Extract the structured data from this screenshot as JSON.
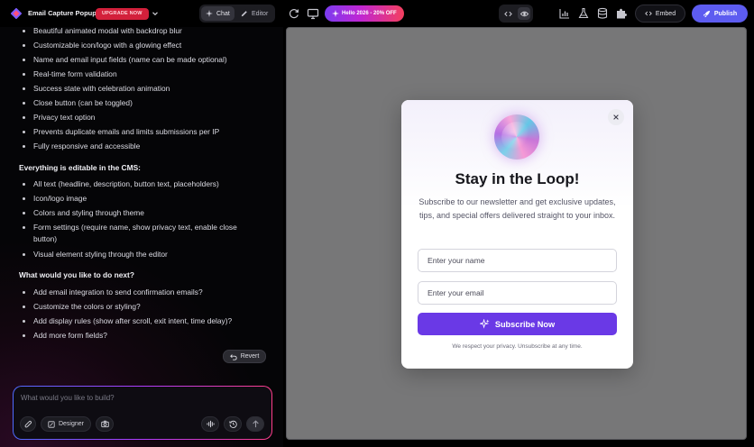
{
  "header": {
    "app_title": "Email Capture Popup",
    "badge": "UPGRADE NOW",
    "tabs": [
      {
        "label": "Chat",
        "icon": "sparkle-icon",
        "active": true
      },
      {
        "label": "Editor",
        "icon": "pencil-icon",
        "active": false
      }
    ],
    "promo": "Hello 2026 - 20% OFF",
    "embed_label": "Embed",
    "publish_label": "Publish",
    "colors": {
      "badge": "#d3203b",
      "publish": "#5d5cf0"
    }
  },
  "chat": {
    "list_a": [
      "Beautiful animated modal with backdrop blur",
      "Customizable icon/logo with a glowing effect",
      "Name and email input fields (name can be made optional)",
      "Real-time form validation",
      "Success state with celebration animation",
      "Close button (can be toggled)",
      "Privacy text option",
      "Prevents duplicate emails and limits submissions per IP",
      "Fully responsive and accessible"
    ],
    "heading_b": "Everything is editable in the CMS:",
    "list_b": [
      "All text (headline, description, button text, placeholders)",
      "Icon/logo image",
      "Colors and styling through theme",
      "Form settings (require name, show privacy text, enable close button)",
      "Visual element styling through the editor"
    ],
    "heading_c": "What would you like to do next?",
    "list_c": [
      "Add email integration to send confirmation emails?",
      "Customize the colors or styling?",
      "Add display rules (show after scroll, exit intent, time delay)?",
      "Add more form fields?"
    ],
    "revert_label": "Revert",
    "composer_placeholder": "What would you like to build?",
    "designer_label": "Designer"
  },
  "preview": {
    "title": "Stay in the Loop!",
    "description": "Subscribe to our newsletter and get exclusive updates, tips, and special offers delivered straight to your inbox.",
    "name_placeholder": "Enter your name",
    "email_placeholder": "Enter your email",
    "button_label": "Subscribe Now",
    "privacy": "We respect your privacy. Unsubscribe at any time.",
    "button_color": "#6a39e6"
  }
}
